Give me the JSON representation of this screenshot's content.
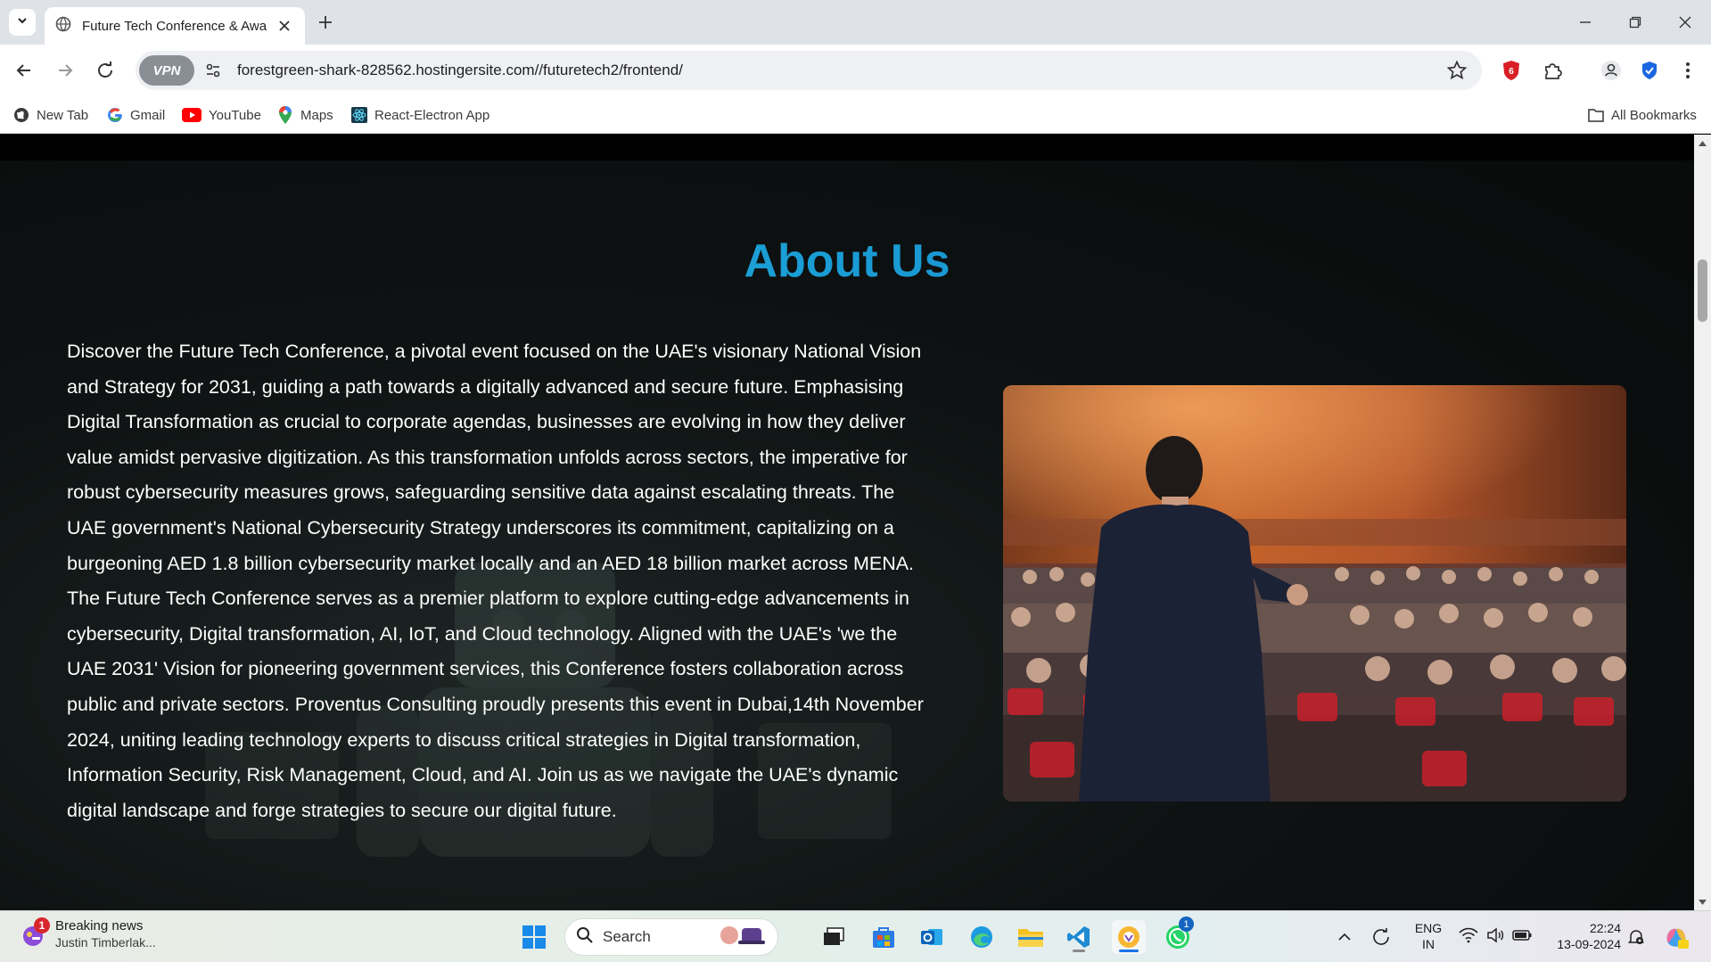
{
  "browser": {
    "tab_title": "Future Tech Conference & Awa",
    "url": "forestgreen-shark-828562.hostingersite.com//futuretech2/frontend/",
    "vpn_label": "VPN",
    "bookmarks": [
      "New Tab",
      "Gmail",
      "YouTube",
      "Maps",
      "React-Electron App"
    ],
    "all_bookmarks": "All Bookmarks"
  },
  "page": {
    "title": "About Us",
    "paragraphs": [
      "Discover the Future Tech Conference, a pivotal event focused on the UAE's visionary National Vision and Strategy for 2031, guiding a path towards a digitally advanced and secure future. Emphasising Digital Transformation as crucial to corporate agendas, businesses are evolving in how they deliver value amidst pervasive digitization. As this transformation unfolds across sectors, the imperative for robust cybersecurity measures grows, safeguarding sensitive data against escalating threats. The UAE government's National Cybersecurity Strategy underscores its commitment, capitalizing on a burgeoning AED 1.8 billion cybersecurity market locally and an AED 18 billion market across MENA.",
      "The Future Tech Conference serves as a premier platform to explore cutting-edge advancements in cybersecurity, Digital transformation, AI, IoT, and Cloud technology. Aligned with the UAE's 'we the UAE 2031' Vision for pioneering government services, this Conference fosters collaboration across public and private sectors. Proventus Consulting proudly presents this event in Dubai,14th November 2024, uniting leading technology experts to discuss critical strategies in Digital transformation, Information Security, Risk Management, Cloud, and AI. Join us as we navigate the UAE's dynamic digital landscape and forge strategies to secure our digital future."
    ],
    "title_gradient": [
      "#1fb7d8",
      "#1580cf"
    ]
  },
  "taskbar": {
    "news_title": "Breaking news",
    "news_sub": "Justin Timberlak...",
    "news_badge": "1",
    "search_label": "Search",
    "whatsapp_badge": "1",
    "lang_top": "ENG",
    "lang_bottom": "IN",
    "time": "22:24",
    "date": "13-09-2024"
  }
}
